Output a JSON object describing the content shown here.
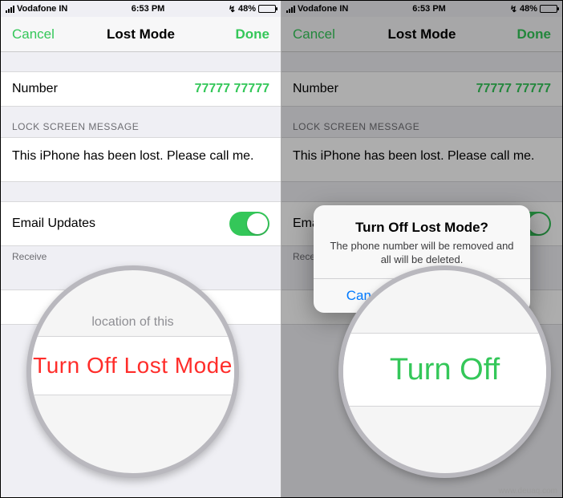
{
  "statusbar": {
    "carrier": "Vodafone IN",
    "time": "6:53 PM",
    "battery_pct": "48%"
  },
  "nav": {
    "cancel": "Cancel",
    "title": "Lost Mode",
    "done": "Done"
  },
  "number_row": {
    "label": "Number",
    "value": "77777 77777"
  },
  "lock_section_header": "LOCK SCREEN MESSAGE",
  "lock_message": "This iPhone has been lost. Please call me.",
  "email_row": {
    "label": "Email Updates",
    "receive_note": "Receive"
  },
  "turn_off_row": "Turn Off Lost Mode",
  "magnifier_left": {
    "hint_top": "location of this",
    "text": "Turn Off Lost Mode"
  },
  "magnifier_right": {
    "text": "Turn Off"
  },
  "alert": {
    "title": "Turn Off Lost Mode?",
    "message": "The phone number will be removed and all will be deleted.",
    "cancel": "Cancel",
    "confirm": "Turn Off"
  },
  "watermark": "www.deuaq.com",
  "colors": {
    "accent_green": "#34c759",
    "accent_red": "#ff3b30"
  }
}
